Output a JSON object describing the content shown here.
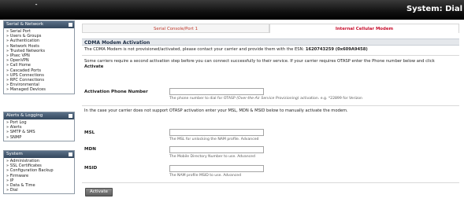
{
  "header": {
    "title": "System: Dial"
  },
  "sidebar": {
    "serial_network": {
      "title": "Serial & Network",
      "items": [
        "Serial Port",
        "Users & Groups",
        "Authentication",
        "Network Hosts",
        "Trusted Networks",
        "IPsec VPN",
        "OpenVPN",
        "Call Home",
        "Cascaded Ports",
        "UPS Connections",
        "RPC Connections",
        "Environmental",
        "Managed Devices"
      ]
    },
    "alerts_logging": {
      "title": "Alerts & Logging",
      "items": [
        "Port Log",
        "Alerts",
        "SMTP & SMS",
        "SNMP"
      ]
    },
    "system": {
      "title": "System",
      "items": [
        "Administration",
        "SSL Certificates",
        "Configuration Backup",
        "Firmware",
        "IP",
        "Data & Time",
        "Dial"
      ]
    }
  },
  "tabs": [
    {
      "label": "Serial Console/Port 1"
    },
    {
      "label": "Internal Cellular Modem"
    }
  ],
  "section": {
    "title": "CDMA Modem Activation",
    "intro_text": "The CDMA Modem is not provisioned/activated, please contact your carrier and provide them with the ESN:",
    "esn": "1620743259 (0x609A9458)",
    "otasp_text": "Some carriers require a second activation step before you can connect successfully to their service. If your carrier requires OTASP enter the Phone number below and click",
    "otasp_action": "Activate",
    "manual_text": "In the case your carrier does not support OTASP activation enter your MSL, MDN & MSID below to manually activate the modem."
  },
  "fields": {
    "phone": {
      "label": "Activation Phone Number",
      "value": "",
      "hint_prefix": "The phone number to dial for OTASP",
      "hint_italic": "(Over-the-Air Service Provisioning)",
      "hint_suffix": "activation. e.g. *22899 for Verizon"
    },
    "msl": {
      "label": "MSL",
      "value": "",
      "hint": "The MSL for unlocking the NAM profile. Advanced"
    },
    "mdn": {
      "label": "MDN",
      "value": "",
      "hint": "The Mobile Directory Number to use. Advanced"
    },
    "msid": {
      "label": "MSID",
      "value": "",
      "hint": "The NAM profile MSID to use. Advanced"
    }
  },
  "buttons": {
    "activate": "Activate"
  }
}
